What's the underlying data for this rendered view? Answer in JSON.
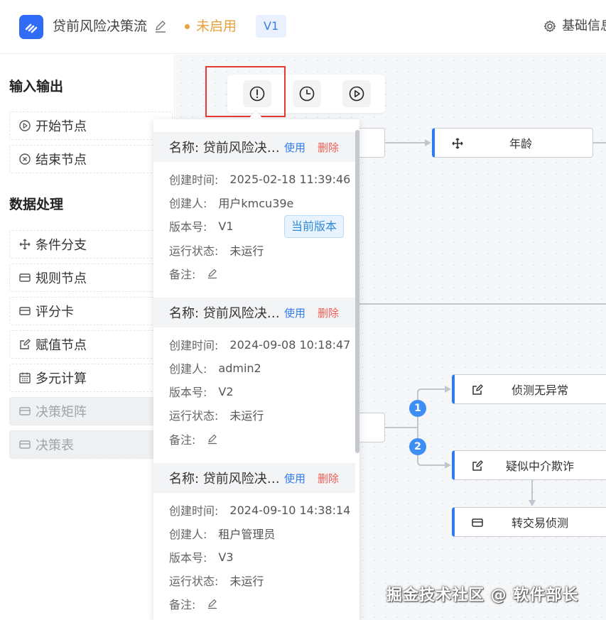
{
  "header": {
    "title": "贷前风险决策流",
    "status": "未启用",
    "version": "V1",
    "basic_info": "基础信息"
  },
  "sidebar": {
    "sections": [
      {
        "title": "输入输出",
        "items": [
          {
            "label": "开始节点",
            "icon": "play-circle-icon",
            "disabled": false
          },
          {
            "label": "结束节点",
            "icon": "close-circle-icon",
            "disabled": false
          }
        ]
      },
      {
        "title": "数据处理",
        "items": [
          {
            "label": "条件分支",
            "icon": "move-icon",
            "disabled": false
          },
          {
            "label": "规则节点",
            "icon": "card-icon",
            "disabled": false
          },
          {
            "label": "评分卡",
            "icon": "card-icon",
            "disabled": false
          },
          {
            "label": "赋值节点",
            "icon": "edit-icon",
            "disabled": false
          },
          {
            "label": "多元计算",
            "icon": "calendar-icon",
            "disabled": false
          },
          {
            "label": "决策矩阵",
            "icon": "card-icon",
            "disabled": true
          },
          {
            "label": "决策表",
            "icon": "card-icon",
            "disabled": true
          }
        ]
      }
    ]
  },
  "toolbar": {
    "buttons": [
      {
        "name": "info-icon"
      },
      {
        "name": "history-icon"
      },
      {
        "name": "play-icon"
      }
    ]
  },
  "canvas": {
    "nodes": [
      {
        "label": "年龄",
        "icon": "move-icon"
      },
      {
        "label": "侦测无异常",
        "icon": "edit-icon"
      },
      {
        "label": "疑似中介欺诈",
        "icon": "edit-icon"
      },
      {
        "label": "转交易侦测",
        "icon": "card-icon"
      }
    ],
    "badges": [
      "1",
      "2"
    ]
  },
  "versions": {
    "labels": {
      "created_time": "创建时间:",
      "creator": "创建人:",
      "version_no": "版本号:",
      "run_status": "运行状态:",
      "remark": "备注:",
      "use": "使用",
      "delete": "删除",
      "current": "当前版本"
    },
    "items": [
      {
        "name": "名称: 贷前风险决策流",
        "created_time": "2025-02-18 11:39:46",
        "creator": "用户kmcu39e",
        "version": "V1",
        "run_status": "未运行",
        "current": true
      },
      {
        "name": "名称: 贷前风险决策流",
        "created_time": "2024-09-08 10:18:47",
        "creator": "admin2",
        "version": "V2",
        "run_status": "未运行",
        "current": false
      },
      {
        "name": "名称: 贷前风险决策流",
        "created_time": "2024-09-10 14:38:14",
        "creator": "租户管理员",
        "version": "V3",
        "run_status": "未运行",
        "current": false
      }
    ]
  },
  "watermark": "掘金技术社区 @ 软件部长",
  "colors": {
    "accent": "#2f7bf0",
    "warning": "#e6a23c",
    "danger": "#f25c54",
    "highlight": "#e53935"
  }
}
